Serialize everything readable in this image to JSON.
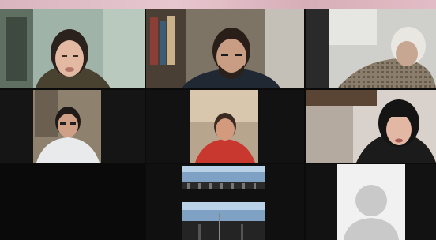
{
  "meeting": {
    "view": "gallery",
    "participants": [
      {
        "id": 1,
        "video": "on",
        "scene": "woman-bookshelf-left"
      },
      {
        "id": 2,
        "video": "on",
        "scene": "man-bookshelf"
      },
      {
        "id": 3,
        "video": "on",
        "scene": "elderly-person"
      },
      {
        "id": 4,
        "video": "on",
        "scene": "man-white-shirt"
      },
      {
        "id": 5,
        "video": "on",
        "scene": "person-red-shirt"
      },
      {
        "id": 6,
        "video": "on",
        "scene": "woman-black-hair"
      },
      {
        "id": 7,
        "video": "off",
        "scene": "dark"
      },
      {
        "id": 8,
        "video": "on",
        "scene": "shared-screen-dark"
      },
      {
        "id": 9,
        "video": "off",
        "scene": "avatar-placeholder"
      }
    ]
  },
  "colors": {
    "background": "#0b0b0b",
    "top_strip": "#e2bcc6",
    "avatar_bg": "#f1f1f1",
    "avatar_figure": "#c9c9c9"
  }
}
